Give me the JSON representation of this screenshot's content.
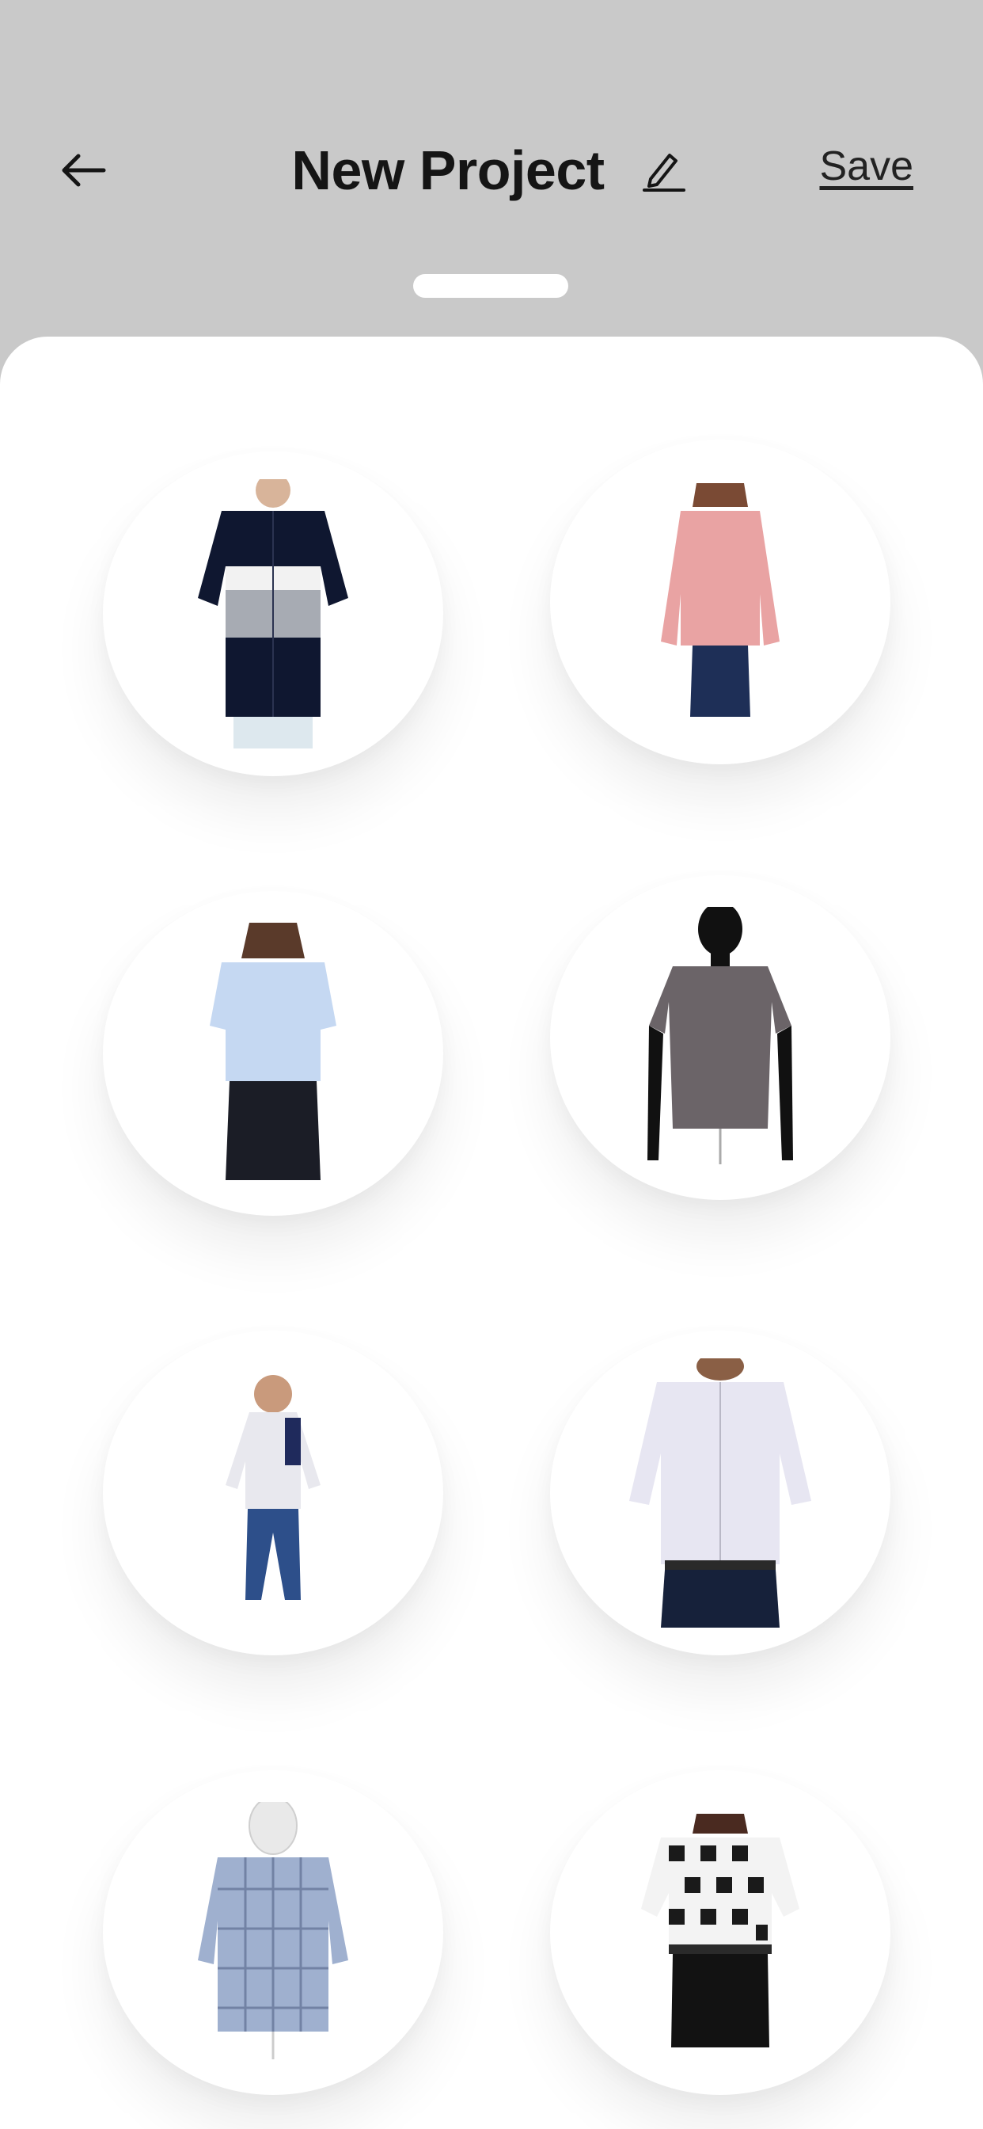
{
  "header": {
    "title": "New Project",
    "save_label": "Save",
    "back_icon": "arrow-left-icon",
    "edit_icon": "pencil-icon"
  },
  "colors": {
    "header_bg": "#c9c9c9",
    "sheet_bg": "#ffffff",
    "text": "#151515"
  },
  "items": [
    {
      "name": "colorblock-shirt-man",
      "desc_icon": "shirt-icon"
    },
    {
      "name": "pink-blouse-girl",
      "desc_icon": "shirt-icon"
    },
    {
      "name": "light-blue-shirt-woman",
      "desc_icon": "shirt-icon"
    },
    {
      "name": "grey-polo-mannequin",
      "desc_icon": "shirt-icon"
    },
    {
      "name": "boy-printed-shirt",
      "desc_icon": "shirt-icon"
    },
    {
      "name": "white-shirt-man",
      "desc_icon": "shirt-icon"
    },
    {
      "name": "checked-shirt-mannequin",
      "desc_icon": "shirt-icon"
    },
    {
      "name": "black-white-check-shirt-woman",
      "desc_icon": "shirt-icon"
    }
  ]
}
